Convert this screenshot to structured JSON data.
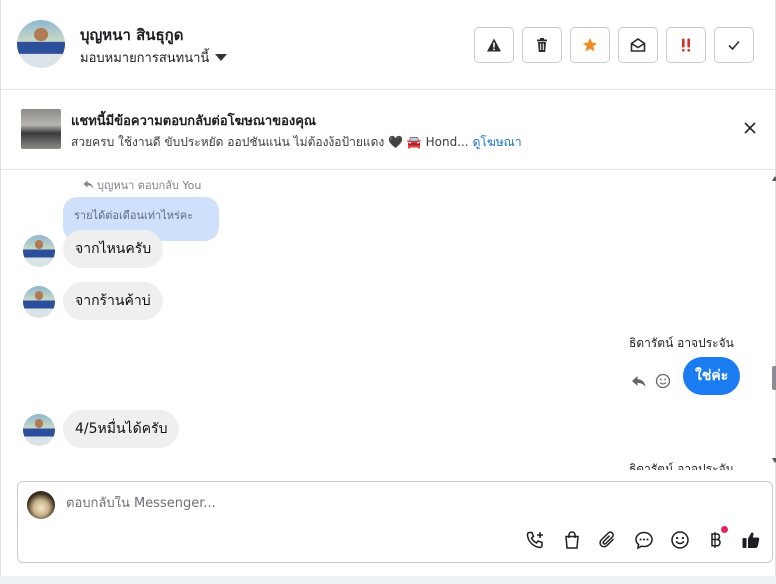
{
  "header": {
    "contact_name": "บุญหนา สินธุกูด",
    "assign_label": "มอบหมายการสนทนานี้",
    "toolbar": [
      {
        "name": "report-spam-button",
        "icon": "warning-icon"
      },
      {
        "name": "delete-button",
        "icon": "trash-icon"
      },
      {
        "name": "star-button",
        "icon": "star-icon"
      },
      {
        "name": "mark-unread-button",
        "icon": "envelope-open-icon"
      },
      {
        "name": "follow-up-button",
        "icon": "double-exclamation-icon"
      },
      {
        "name": "mark-done-button",
        "icon": "check-icon"
      }
    ]
  },
  "ad_banner": {
    "title": "แชทนี้มีข้อความตอบกลับต่อโฆษณาของคุณ",
    "description": "สวยครบ ใช้งานดี ขับประหยัด ออปชันแน่น ไม่ต้องง้อป้ายแดง 🖤 🚘 Hond...",
    "link": "ดูโฆษณา"
  },
  "messages": {
    "reply_hint": "บุญหนา ตอบกลับ You",
    "quoted": "รายได้ต่อเดือนเท่าไหร่คะ",
    "incoming_1": "จากไหนครับ",
    "incoming_2": "จากร้านค้าบ่",
    "outgoing_sender": "ธิดารัตน์ อาจประจัน",
    "outgoing_1": "ใช่ค่ะ",
    "incoming_3": "4/5หมื่นได้ครับ",
    "outgoing_sender_2": "ธิดารัตน์ อาจประจัน"
  },
  "composer": {
    "placeholder": "ตอบกลับใน Messenger...",
    "icons": [
      "call-plus-icon",
      "shopping-bag-icon",
      "paperclip-icon",
      "chat-bubble-icon",
      "emoji-icon",
      "baht-icon",
      "thumbs-up-icon"
    ]
  },
  "colors": {
    "accent": "#1b7cf2",
    "quoted_bubble": "#cfe0fb",
    "incoming_bubble": "#efefef",
    "star": "#f08a24",
    "alert": "#d93025"
  }
}
